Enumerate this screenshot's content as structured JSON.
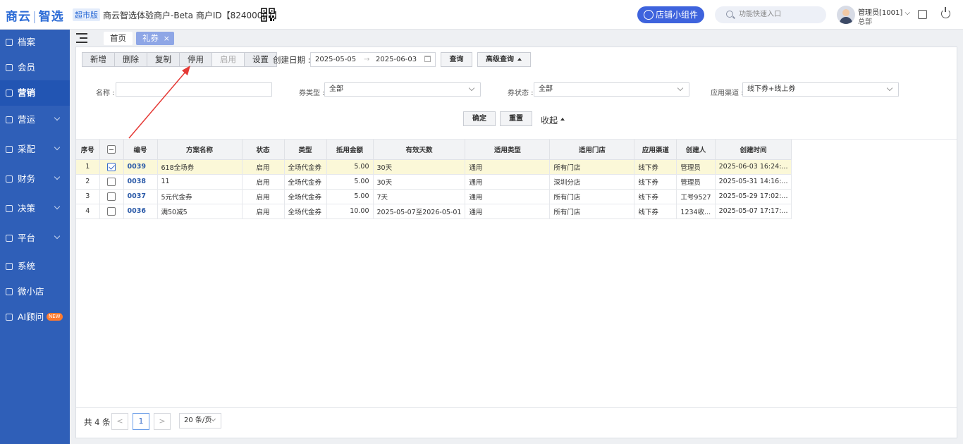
{
  "header": {
    "logo_a": "商云",
    "logo_sep": "|",
    "logo_b": "智选",
    "edition": "超市版",
    "merchant": "商云智选体验商户-Beta  商户ID【82400001】",
    "shop_widget_label": "店铺小组件",
    "search_placeholder": "功能快速入口",
    "user_name": "管理员[1001]",
    "user_dept": "总部"
  },
  "sidebar": {
    "items": [
      {
        "label": "档案",
        "has_arrow": false
      },
      {
        "label": "会员",
        "has_arrow": false
      },
      {
        "label": "营销",
        "has_arrow": false,
        "active": true
      },
      {
        "label": "营运",
        "has_arrow": true
      },
      {
        "label": "采配",
        "has_arrow": true
      },
      {
        "label": "财务",
        "has_arrow": true
      },
      {
        "label": "决策",
        "has_arrow": true
      },
      {
        "label": "平台",
        "has_arrow": true
      },
      {
        "label": "系统",
        "has_arrow": false
      },
      {
        "label": "微小店",
        "has_arrow": false
      },
      {
        "label": "AI顾问",
        "has_arrow": false
      }
    ],
    "new_badge": "NEW",
    "bg_color": "#2f5fb8"
  },
  "tabs": {
    "home": "首页",
    "current": "礼券",
    "close": "×"
  },
  "toolbar": {
    "buttons": [
      "新增",
      "删除",
      "复制",
      "停用",
      "启用",
      "设置"
    ],
    "date_label": "创建日期 :",
    "date_start": "2025-05-05",
    "date_arrow": "→",
    "date_end": "2025-06-03",
    "query": "查询",
    "advanced_query": "高级查询"
  },
  "filters": {
    "name_label": "名称 :",
    "name_value": "",
    "coupon_type_label": "券类型 :",
    "coupon_type_value": "全部",
    "coupon_status_label": "券状态 :",
    "coupon_status_value": "全部",
    "channel_label": "应用渠道 :",
    "channel_value": "线下券+线上券",
    "confirm": "确定",
    "reset": "重置",
    "collapse": "收起"
  },
  "table": {
    "columns": [
      "序号",
      "",
      "编号",
      "方案名称",
      "状态",
      "类型",
      "抵用金额",
      "有效天数",
      "适用类型",
      "适用门店",
      "应用渠道",
      "创建人",
      "创建时间"
    ],
    "rows": [
      {
        "seq": "1",
        "checked": true,
        "code": "0039",
        "name": "618全场券",
        "status": "启用",
        "type": "全场代金券",
        "amount": "5.00",
        "validity": "30天",
        "apply_type": "通用",
        "store": "所有门店",
        "channel": "线下券",
        "creator": "管理员",
        "created": "2025-06-03 16:24:..."
      },
      {
        "seq": "2",
        "checked": false,
        "code": "0038",
        "name": "11",
        "status": "启用",
        "type": "全场代金券",
        "amount": "5.00",
        "validity": "30天",
        "apply_type": "通用",
        "store": "深圳分店",
        "channel": "线下券",
        "creator": "管理员",
        "created": "2025-05-31 14:16:..."
      },
      {
        "seq": "3",
        "checked": false,
        "code": "0037",
        "name": "5元代金券",
        "status": "启用",
        "type": "全场代金券",
        "amount": "5.00",
        "validity": "7天",
        "apply_type": "通用",
        "store": "所有门店",
        "channel": "线下券",
        "creator": "工号9527",
        "created": "2025-05-29 17:02:..."
      },
      {
        "seq": "4",
        "checked": false,
        "code": "0036",
        "name": "满50减5",
        "status": "启用",
        "type": "全场代金券",
        "amount": "10.00",
        "validity": "2025-05-07至2026-05-01",
        "apply_type": "通用",
        "store": "所有门店",
        "channel": "线下券",
        "creator": "1234收...",
        "created": "2025-05-07 17:17:..."
      }
    ]
  },
  "pager": {
    "total": "共 4 条",
    "prev": "<",
    "current": "1",
    "next": ">",
    "page_size": "20 条/页"
  },
  "colors": {
    "accent": "#3e63dd",
    "annotation_arrow": "#e53935",
    "selected_row": "#fbf8d8"
  }
}
